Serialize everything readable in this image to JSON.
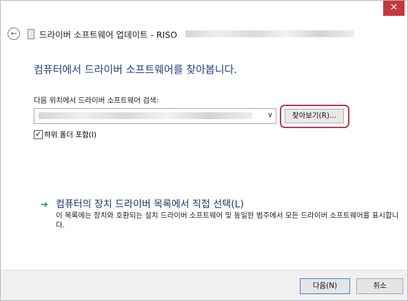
{
  "window": {
    "close_glyph": "✕"
  },
  "header": {
    "back_glyph": "←",
    "title": "드라이버 소프트웨어 업데이트 - RISO"
  },
  "main": {
    "heading": "컴퓨터에서 드라이버 소프트웨어를 찾아봅니다.",
    "location_label": "다음 위치에서 드라이버 소프트웨어 검색:",
    "dropdown_arrow": "∨",
    "browse_label": "찾아보기(R)...",
    "include_subfolders": {
      "checked": true,
      "mark": "✓",
      "label": "하위 폴더 포함(I)"
    },
    "pick_link": {
      "arrow": "➔",
      "title": "컴퓨터의 장치 드라이버 목록에서 직접 선택(L)",
      "description": "이 목록에는 장치와 호환되는 설치 드라이버 소프트웨어 및 동일한 범주에서 모든 드라이버 소프트웨어를 표시합니다."
    }
  },
  "footer": {
    "next_label": "다음(N)",
    "cancel_label": "취소"
  },
  "colors": {
    "accent": "#1c3f8f",
    "highlight_ring": "#c0363f",
    "close_button": "#c7383a"
  },
  "icons": [
    "close-icon",
    "back-arrow-icon",
    "driver-icon",
    "chevron-down-icon",
    "green-arrow-icon"
  ]
}
